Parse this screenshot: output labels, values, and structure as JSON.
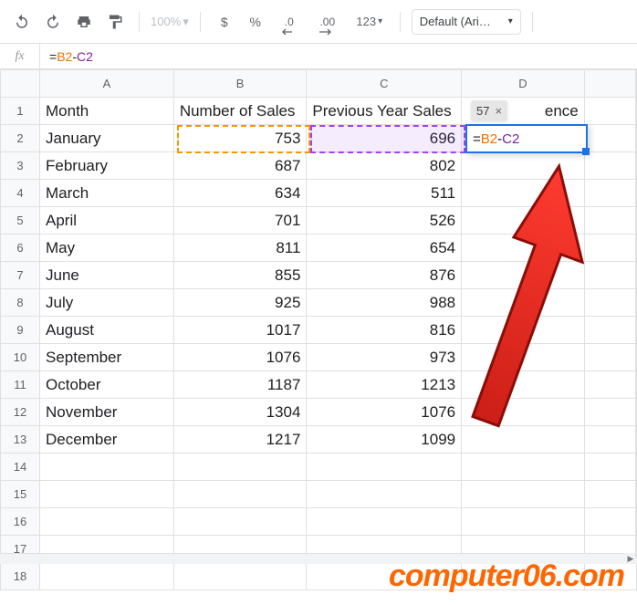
{
  "toolbar": {
    "zoom_value": "100%",
    "currency_label": "$",
    "percent_label": "%",
    "dec_less": ".0",
    "dec_more": ".00",
    "fmt_more": "123",
    "font_name": "Default (Ari…"
  },
  "formula_bar": {
    "fx_label": "fx",
    "prefix": "=",
    "ref1": "B2",
    "op": "-",
    "ref2": "C2"
  },
  "columns": [
    "A",
    "B",
    "C",
    "D"
  ],
  "headers": {
    "A": "Month",
    "B": "Number of Sales",
    "C": "Previous Year Sales",
    "D_suffix": "ence"
  },
  "rows": [
    {
      "n": "1"
    },
    {
      "n": "2",
      "month": "January",
      "b": "753",
      "c": "696"
    },
    {
      "n": "3",
      "month": "February",
      "b": "687",
      "c": "802"
    },
    {
      "n": "4",
      "month": "March",
      "b": "634",
      "c": "511"
    },
    {
      "n": "5",
      "month": "April",
      "b": "701",
      "c": "526"
    },
    {
      "n": "6",
      "month": "May",
      "b": "811",
      "c": "654"
    },
    {
      "n": "7",
      "month": "June",
      "b": "855",
      "c": "876"
    },
    {
      "n": "8",
      "month": "July",
      "b": "925",
      "c": "988"
    },
    {
      "n": "9",
      "month": "August",
      "b": "1017",
      "c": "816"
    },
    {
      "n": "10",
      "month": "September",
      "b": "1076",
      "c": "973"
    },
    {
      "n": "11",
      "month": "October",
      "b": "1187",
      "c": "1213"
    },
    {
      "n": "12",
      "month": "November",
      "b": "1304",
      "c": "1076"
    },
    {
      "n": "13",
      "month": "December",
      "b": "1217",
      "c": "1099"
    },
    {
      "n": "14"
    },
    {
      "n": "15"
    },
    {
      "n": "16"
    },
    {
      "n": "17"
    },
    {
      "n": "18"
    }
  ],
  "result_tip": {
    "value": "57",
    "close": "×"
  },
  "active_cell": {
    "prefix": "=",
    "ref1": "B2",
    "op": "-",
    "ref2": "C2"
  },
  "watermark": "computer06.com",
  "chart_data": {
    "type": "table",
    "title": "",
    "columns": [
      "Month",
      "Number of Sales",
      "Previous Year Sales"
    ],
    "data": [
      [
        "January",
        753,
        696
      ],
      [
        "February",
        687,
        802
      ],
      [
        "March",
        634,
        511
      ],
      [
        "April",
        701,
        526
      ],
      [
        "May",
        811,
        654
      ],
      [
        "June",
        855,
        876
      ],
      [
        "July",
        925,
        988
      ],
      [
        "August",
        1017,
        816
      ],
      [
        "September",
        1076,
        973
      ],
      [
        "October",
        1187,
        1213
      ],
      [
        "November",
        1304,
        1076
      ],
      [
        "December",
        1217,
        1099
      ]
    ],
    "editing_formula": "=B2-C2",
    "formula_result": 57
  }
}
